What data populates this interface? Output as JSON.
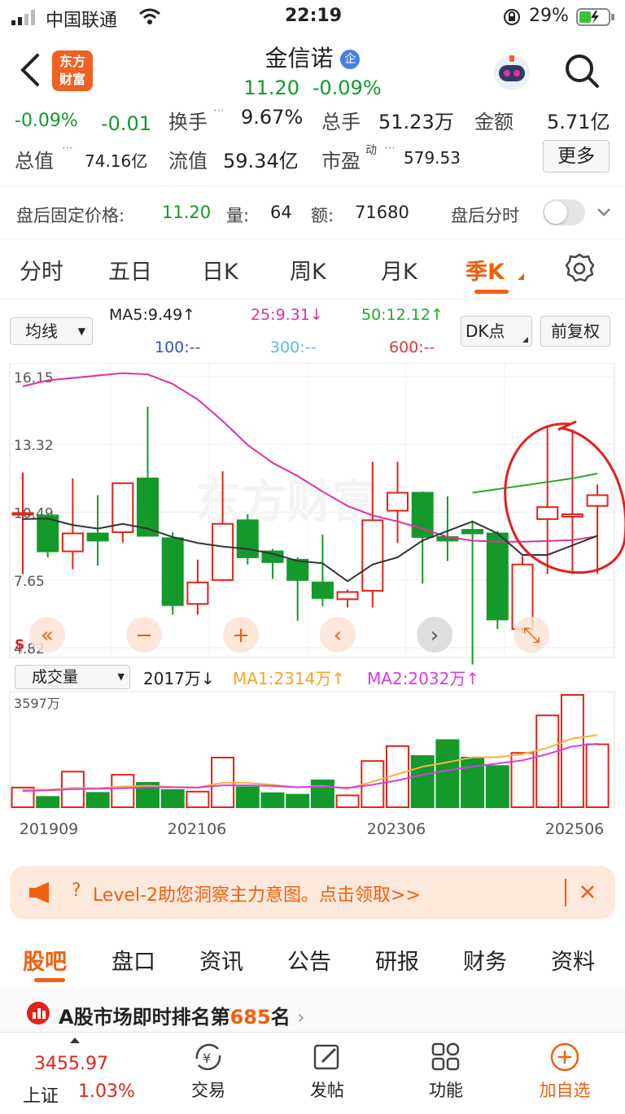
{
  "statusbar": {
    "carrier": "中国联通",
    "time": "22:19",
    "battery": "29%"
  },
  "header": {
    "logo_text": "东方财富",
    "stock_name": "金信诺",
    "badge": "企",
    "price": "11.20",
    "change_pct": "-0.09%"
  },
  "quote": {
    "change_pct": "-0.09%",
    "change": "-0.01",
    "turnover_label": "换手",
    "turnover": "9.67%",
    "volume_label": "总手",
    "volume": "51.23万",
    "amount_label": "金额",
    "amount": "5.71亿",
    "mktcap_label": "总值",
    "mktcap": "74.16亿",
    "float_label": "流值",
    "float": "59.34亿",
    "pe_label": "市盈",
    "pe_sup": "动",
    "pe": "579.53",
    "more_button": "更多"
  },
  "afterhours": {
    "label": "盘后固定价格:",
    "price": "11.20",
    "vol_label": "量:",
    "vol": "64",
    "amt_label": "额:",
    "amt": "71680",
    "toggle_label": "盘后分时"
  },
  "period_tabs": [
    "分时",
    "五日",
    "日K",
    "周K",
    "月K",
    "季K"
  ],
  "ma_legend": {
    "selector": "均线",
    "ma5": "MA5:9.49↑",
    "ma25": "25:9.31↓",
    "ma50": "50:12.12↑",
    "ma100": "100:--",
    "ma300": "300:--",
    "ma600": "600:--",
    "dk_button": "DK点",
    "fq_button": "前复权"
  },
  "colors": {
    "up": "#e2231a",
    "down": "#139a2b",
    "accent": "#f0600f",
    "ma5": "#333333",
    "ma25": "#e0309c",
    "ma50": "#22a82e",
    "ma100": "#2e53c8",
    "ma300": "#5eb8ec",
    "ma600": "#d83b3b"
  },
  "chart_data": {
    "type": "candlestick",
    "title": "",
    "y_ticks": [
      "16.15",
      "13.32",
      "10.49",
      "7.65",
      "4.82"
    ],
    "ylim": [
      4.82,
      16.15
    ],
    "candles": [
      {
        "o": 10.45,
        "h": 12.15,
        "l": 7.9,
        "c": 10.45
      },
      {
        "o": 10.35,
        "h": 10.45,
        "l": 8.6,
        "c": 8.85
      },
      {
        "o": 8.85,
        "h": 11.9,
        "l": 8.1,
        "c": 9.6
      },
      {
        "o": 9.6,
        "h": 11.2,
        "l": 8.25,
        "c": 9.3
      },
      {
        "o": 9.65,
        "h": 11.65,
        "l": 9.2,
        "c": 11.7
      },
      {
        "o": 11.9,
        "h": 14.9,
        "l": 9.6,
        "c": 9.5
      },
      {
        "o": 9.4,
        "h": 9.65,
        "l": 6.2,
        "c": 6.6
      },
      {
        "o": 6.65,
        "h": 8.5,
        "l": 6.2,
        "c": 7.55
      },
      {
        "o": 7.65,
        "h": 12.2,
        "l": 7.6,
        "c": 10.0
      },
      {
        "o": 10.15,
        "h": 10.4,
        "l": 8.3,
        "c": 8.6
      },
      {
        "o": 8.85,
        "h": 8.95,
        "l": 7.7,
        "c": 8.4
      },
      {
        "o": 8.5,
        "h": 8.6,
        "l": 5.95,
        "c": 7.65
      },
      {
        "o": 7.55,
        "h": 9.55,
        "l": 6.55,
        "c": 6.9
      },
      {
        "o": 6.85,
        "h": 7.25,
        "l": 6.5,
        "c": 7.15
      },
      {
        "o": 7.2,
        "h": 12.6,
        "l": 6.5,
        "c": 10.15
      },
      {
        "o": 10.55,
        "h": 12.6,
        "l": 9.2,
        "c": 11.3
      },
      {
        "o": 11.3,
        "h": 11.35,
        "l": 7.5,
        "c": 9.45
      },
      {
        "o": 9.45,
        "h": 11.15,
        "l": 8.45,
        "c": 9.3
      },
      {
        "o": 9.75,
        "h": 10.1,
        "l": 4.12,
        "c": 9.6
      },
      {
        "o": 9.6,
        "h": 9.7,
        "l": 5.6,
        "c": 6.0
      },
      {
        "o": 5.6,
        "h": 8.65,
        "l": 5.4,
        "c": 8.3
      },
      {
        "o": 10.2,
        "h": 14.05,
        "l": 7.9,
        "c": 10.7
      },
      {
        "o": 10.3,
        "h": 13.95,
        "l": 7.9,
        "c": 10.4
      },
      {
        "o": 10.75,
        "h": 11.65,
        "l": 7.9,
        "c": 11.2
      }
    ],
    "ma5": [
      10.2,
      10.22,
      9.95,
      9.8,
      10.0,
      9.8,
      9.45,
      9.2,
      9.05,
      8.95,
      8.75,
      8.45,
      8.35,
      7.6,
      8.3,
      8.6,
      9.3,
      9.7,
      10.1,
      9.6,
      8.7,
      8.7,
      9.1,
      9.5
    ],
    "ma25": [
      15.75,
      16.0,
      16.1,
      16.2,
      16.3,
      16.25,
      15.85,
      15.2,
      14.3,
      13.3,
      12.55,
      12.0,
      11.35,
      10.75,
      10.35,
      10.1,
      9.8,
      9.45,
      9.3,
      9.25,
      9.25,
      9.28,
      9.32,
      9.48
    ],
    "ma50": [
      null,
      null,
      null,
      null,
      null,
      null,
      null,
      null,
      null,
      null,
      null,
      null,
      null,
      null,
      null,
      null,
      null,
      null,
      11.3,
      11.45,
      11.6,
      11.75,
      11.9,
      12.1
    ],
    "nav_buttons": [
      "«",
      "−",
      "+",
      "‹",
      "›",
      "⤡"
    ],
    "volume": {
      "selector": "成交量",
      "current": "2017万↓",
      "ma1_label": "MA1:2314万↑",
      "ma2_label": "MA2:2032万↑",
      "max_label": "3597万",
      "values": [
        630,
        330,
        1140,
        460,
        1040,
        780,
        550,
        500,
        1590,
        640,
        450,
        400,
        860,
        380,
        1480,
        1960,
        1640,
        2150,
        1590,
        1320,
        1740,
        2940,
        3597,
        2017
      ],
      "ma1": [
        560,
        560,
        620,
        610,
        660,
        690,
        650,
        640,
        780,
        780,
        720,
        640,
        680,
        590,
        820,
        1060,
        1300,
        1440,
        1600,
        1600,
        1700,
        1900,
        2200,
        2314
      ],
      "ma2": [
        520,
        540,
        580,
        590,
        610,
        640,
        640,
        630,
        700,
        700,
        680,
        640,
        660,
        620,
        720,
        860,
        1040,
        1180,
        1300,
        1400,
        1500,
        1700,
        1950,
        2032
      ],
      "x_ticks": [
        "201909",
        "202106",
        "202306",
        "202506"
      ]
    }
  },
  "banner": {
    "text": "Level-2助您洞察主力意图。点击领取>>",
    "prefix": "?"
  },
  "section_tabs": [
    "股吧",
    "盘口",
    "资讯",
    "公告",
    "研报",
    "财务",
    "资料"
  ],
  "rank": {
    "prefix": "A股市场即时排名第",
    "number": "685",
    "suffix": "名"
  },
  "tabbar": {
    "index_value": "3455.97",
    "index_name": "上证",
    "index_change": "1.03%",
    "items": [
      "交易",
      "发帖",
      "功能",
      "加自选"
    ]
  }
}
